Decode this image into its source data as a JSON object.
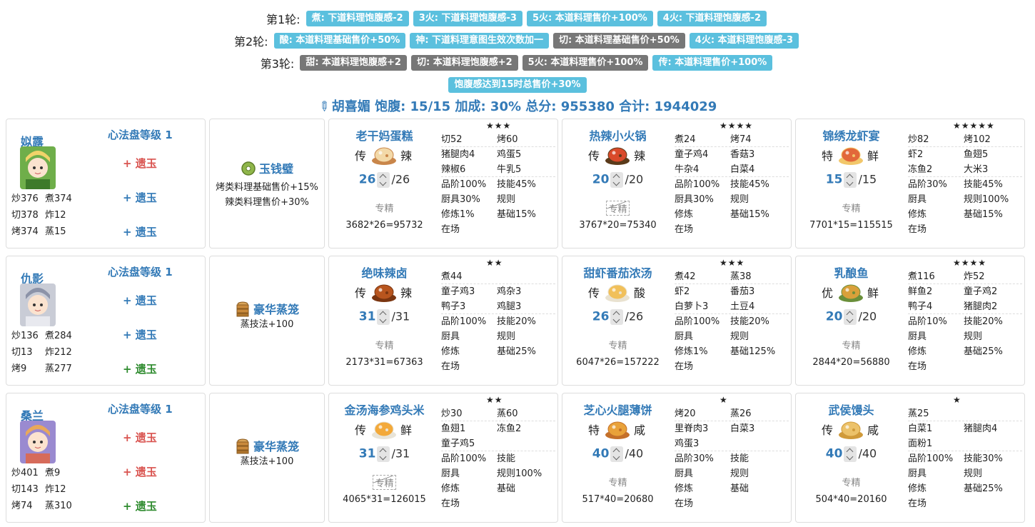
{
  "rounds": [
    {
      "label": "第1轮:",
      "tags": [
        {
          "text": "煮: 下道料理饱腹感-2",
          "color": "blue"
        },
        {
          "text": "3火: 下道料理饱腹感-3",
          "color": "blue"
        },
        {
          "text": "5火: 本道料理售价+100%",
          "color": "blue"
        },
        {
          "text": "4火: 下道料理饱腹感-2",
          "color": "blue"
        }
      ]
    },
    {
      "label": "第2轮:",
      "tags": [
        {
          "text": "酸: 本道料理基础售价+50%",
          "color": "blue"
        },
        {
          "text": "神: 下道料理意图生效次数加一",
          "color": "blue"
        },
        {
          "text": "切: 本道料理基础售价+50%",
          "color": "gray"
        },
        {
          "text": "4火: 本道料理饱腹感-3",
          "color": "blue"
        }
      ]
    },
    {
      "label": "第3轮:",
      "tags": [
        {
          "text": "甜: 本道料理饱腹感+2",
          "color": "gray"
        },
        {
          "text": "切: 本道料理饱腹感+2",
          "color": "gray"
        },
        {
          "text": "5火: 本道料理售价+100%",
          "color": "gray"
        },
        {
          "text": "传: 本道料理售价+100%",
          "color": "blue"
        }
      ]
    },
    {
      "label": "",
      "tags": [
        {
          "text": "饱腹感达到15时总售价+30%",
          "color": "blue"
        }
      ]
    }
  ],
  "summary": {
    "icon": "pin-icon",
    "text": "胡喜媚 饱腹: 15/15 加成: 30% 总分: 955380 合计: 1944029"
  },
  "rows": [
    {
      "chef": {
        "name": "姒露",
        "stats": [
          [
            "炒376",
            "煮374"
          ],
          [
            "切378",
            "炸12"
          ],
          [
            "烤374",
            "蒸15"
          ]
        ],
        "pan_level": "心法盘等级 1",
        "slots": [
          {
            "text": "+ 遗玉",
            "color": "red"
          },
          {
            "text": "+ 遗玉",
            "color": "blue"
          },
          {
            "text": "+ 遗玉",
            "color": "blue"
          }
        ]
      },
      "equip": {
        "name": "玉钱璧",
        "icon": "jade-coin-icon",
        "effects": [
          "烤类料理基础售价+15%",
          "辣类料理售价+30%"
        ]
      },
      "dishes": [
        {
          "name": "老干妈蛋糕",
          "stars": "★★★",
          "grade": "传",
          "flavor": "辣",
          "icon": "cake-icon",
          "qty": "26",
          "max": "/26",
          "skill": "专精",
          "skill_struck": false,
          "calc": "3682*26=95732",
          "rows": [
            [
              "切52",
              "烤60"
            ],
            [
              "猪腿肉4",
              "鸡蛋5"
            ],
            [
              "辣椒6",
              "牛乳5"
            ],
            [
              "品阶100%",
              "技能45%"
            ],
            [
              "厨具30%",
              "规则"
            ],
            [
              "修炼1%",
              "基础15%"
            ],
            [
              "在场",
              ""
            ]
          ]
        },
        {
          "name": "热辣小火锅",
          "stars": "★★★★",
          "grade": "传",
          "flavor": "辣",
          "icon": "hotpot-icon",
          "qty": "20",
          "max": "/20",
          "skill": "专精",
          "skill_struck": true,
          "calc": "3767*20=75340",
          "rows": [
            [
              "煮24",
              "烤74"
            ],
            [
              "童子鸡4",
              "香菇3"
            ],
            [
              "牛杂4",
              "白菜4"
            ],
            [
              "品阶100%",
              "技能45%"
            ],
            [
              "厨具30%",
              "规则"
            ],
            [
              "修炼",
              "基础15%"
            ],
            [
              "在场",
              ""
            ]
          ]
        },
        {
          "name": "锦绣龙虾宴",
          "stars": "★★★★★",
          "grade": "特",
          "flavor": "鲜",
          "icon": "lobster-icon",
          "qty": "15",
          "max": "/15",
          "skill": "专精",
          "skill_struck": false,
          "calc": "7701*15=115515",
          "rows": [
            [
              "炒82",
              "烤102"
            ],
            [
              "虾2",
              "鱼翅5"
            ],
            [
              "冻鱼2",
              "大米3"
            ],
            [
              "品阶30%",
              "技能45%"
            ],
            [
              "厨具",
              "规则100%"
            ],
            [
              "修炼",
              "基础15%"
            ],
            [
              "在场",
              ""
            ]
          ]
        }
      ]
    },
    {
      "chef": {
        "name": "仇影",
        "stats": [
          [
            "炒136",
            "煮284"
          ],
          [
            "切13",
            "炸212"
          ],
          [
            "烤9",
            "蒸277"
          ]
        ],
        "pan_level": "心法盘等级 1",
        "slots": [
          {
            "text": "+ 遗玉",
            "color": "blue"
          },
          {
            "text": "+ 遗玉",
            "color": "blue"
          },
          {
            "text": "+ 遗玉",
            "color": "green"
          }
        ]
      },
      "equip": {
        "name": "豪华蒸笼",
        "icon": "steamer-icon",
        "effects": [
          "蒸技法+100"
        ]
      },
      "dishes": [
        {
          "name": "绝味辣卤",
          "stars": "★★",
          "grade": "传",
          "flavor": "辣",
          "icon": "braised-icon",
          "qty": "31",
          "max": "/31",
          "skill": "专精",
          "skill_struck": false,
          "calc": "2173*31=67363",
          "rows": [
            [
              "煮44",
              ""
            ],
            [
              "童子鸡3",
              "鸡杂3"
            ],
            [
              "鸭子3",
              "鸡腿3"
            ],
            [
              "品阶100%",
              "技能20%"
            ],
            [
              "厨具",
              "规则"
            ],
            [
              "修炼",
              "基础25%"
            ],
            [
              "在场",
              ""
            ]
          ]
        },
        {
          "name": "甜虾番茄浓汤",
          "stars": "★★★",
          "grade": "传",
          "flavor": "酸",
          "icon": "soup-icon",
          "qty": "26",
          "max": "/26",
          "skill": "专精",
          "skill_struck": false,
          "calc": "6047*26=157222",
          "rows": [
            [
              "煮42",
              "蒸38"
            ],
            [
              "虾2",
              "番茄3"
            ],
            [
              "白萝卜3",
              "土豆4"
            ],
            [
              "品阶100%",
              "技能20%"
            ],
            [
              "厨具",
              "规则"
            ],
            [
              "修炼1%",
              "基础125%"
            ],
            [
              "在场",
              ""
            ]
          ]
        },
        {
          "name": "乳酿鱼",
          "stars": "★★★★",
          "grade": "优",
          "flavor": "鲜",
          "icon": "fish-icon",
          "qty": "20",
          "max": "/20",
          "skill": "专精",
          "skill_struck": false,
          "calc": "2844*20=56880",
          "rows": [
            [
              "煮116",
              "炸52"
            ],
            [
              "鲜鱼2",
              "童子鸡2"
            ],
            [
              "鸭子4",
              "猪腿肉2"
            ],
            [
              "品阶10%",
              "技能20%"
            ],
            [
              "厨具",
              "规则"
            ],
            [
              "修炼",
              "基础25%"
            ],
            [
              "在场",
              ""
            ]
          ]
        }
      ]
    },
    {
      "chef": {
        "name": "桑兰",
        "stats": [
          [
            "炒401",
            "煮9"
          ],
          [
            "切143",
            "炸12"
          ],
          [
            "烤74",
            "蒸310"
          ]
        ],
        "pan_level": "心法盘等级 1",
        "slots": [
          {
            "text": "+ 遗玉",
            "color": "red"
          },
          {
            "text": "+ 遗玉",
            "color": "red"
          },
          {
            "text": "+ 遗玉",
            "color": "green"
          }
        ]
      },
      "equip": {
        "name": "豪华蒸笼",
        "icon": "steamer-icon",
        "effects": [
          "蒸技法+100"
        ]
      },
      "dishes": [
        {
          "name": "金汤海参鸡头米",
          "stars": "★★",
          "grade": "传",
          "flavor": "鲜",
          "icon": "golden-soup-icon",
          "qty": "31",
          "max": "/31",
          "skill": "专精",
          "skill_struck": true,
          "calc": "4065*31=126015",
          "rows": [
            [
              "炒30",
              "蒸60"
            ],
            [
              "鱼翅1",
              "冻鱼2"
            ],
            [
              "童子鸡5",
              ""
            ],
            [
              "品阶100%",
              "技能"
            ],
            [
              "厨具",
              "规则100%"
            ],
            [
              "修炼",
              "基础"
            ],
            [
              "在场",
              ""
            ]
          ]
        },
        {
          "name": "芝心火腿薄饼",
          "stars": "★",
          "grade": "特",
          "flavor": "咸",
          "icon": "pancake-icon",
          "qty": "40",
          "max": "/40",
          "skill": "专精",
          "skill_struck": false,
          "calc": "517*40=20680",
          "rows": [
            [
              "烤20",
              "蒸26"
            ],
            [
              "里脊肉3",
              "白菜3"
            ],
            [
              "鸡蛋3",
              ""
            ],
            [
              "品阶30%",
              "技能"
            ],
            [
              "厨具",
              "规则"
            ],
            [
              "修炼",
              "基础"
            ],
            [
              "在场",
              ""
            ]
          ]
        },
        {
          "name": "武侯馒头",
          "stars": "★",
          "grade": "传",
          "flavor": "咸",
          "icon": "bun-icon",
          "qty": "40",
          "max": "/40",
          "skill": "专精",
          "skill_struck": false,
          "calc": "504*40=20160",
          "rows": [
            [
              "蒸25",
              ""
            ],
            [
              "白菜1",
              "猪腿肉4"
            ],
            [
              "面粉1",
              ""
            ],
            [
              "品阶100%",
              "技能30%"
            ],
            [
              "厨具",
              "规则"
            ],
            [
              "修炼",
              "基础25%"
            ],
            [
              "在场",
              ""
            ]
          ]
        }
      ]
    }
  ],
  "colors": {
    "accent": "#337ab7",
    "tag_blue": "#5bc0de",
    "tag_gray": "#777777",
    "red": "#d9534f",
    "green": "#2e8b2e"
  }
}
